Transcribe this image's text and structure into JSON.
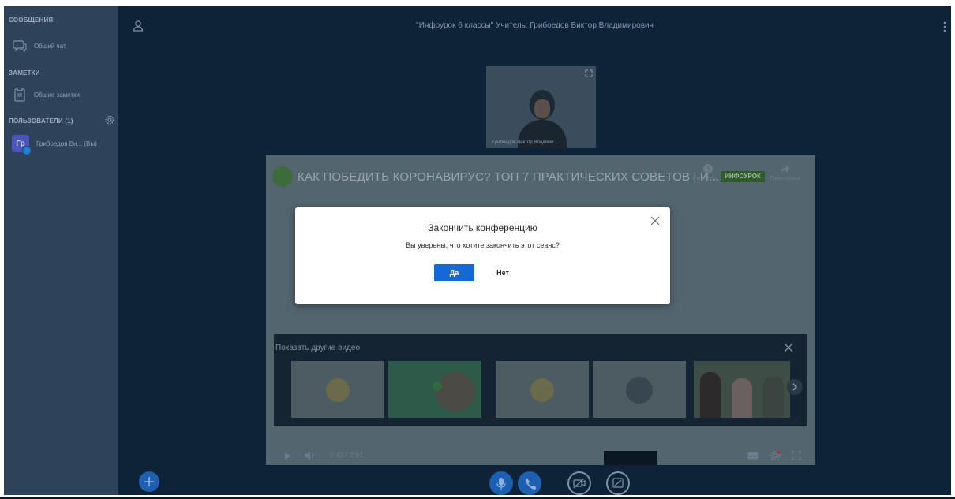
{
  "colors": {
    "sidebar_bg": "#2e4359",
    "main_bg": "#0e2238",
    "primary": "#1469d6",
    "accent_fab": "#1d5fb0"
  },
  "sidebar": {
    "messages_header": "СООБЩЕНИЯ",
    "public_chat": "Общий чат",
    "notes_header": "ЗАМЕТКИ",
    "shared_notes": "Общие заметки",
    "users_header": "ПОЛЬЗОВАТЕЛИ (1)",
    "user": {
      "initials": "Гр",
      "name": "Грибоедов Ви... (Вы)"
    }
  },
  "header": {
    "title": "\"Инфоурок 6 классы\" Учитель: Грибоедов Виктор Владимирович"
  },
  "webcam": {
    "name": "Грибоедов Виктор Владими..."
  },
  "video": {
    "title": "КАК ПОБЕДИТЬ КОРОНАВИРУС? ТОП 7 ПРАКТИЧЕСКИХ СОВЕТОВ | И...",
    "watch_later": "Смотреть ...",
    "share": "Поделиться",
    "brand": "ИНФОУРОК",
    "more_videos_title": "Показать другие видео",
    "time": "0:43 / 2:51"
  },
  "dialog": {
    "title": "Закончить конференцию",
    "text": "Вы уверены, что хотите закончить этот сеанс?",
    "yes": "Да",
    "no": "Нет"
  },
  "controls": {
    "icons": [
      "plus-icon",
      "microphone-icon",
      "phone-icon",
      "camera-off-icon",
      "screenshare-icon"
    ]
  }
}
